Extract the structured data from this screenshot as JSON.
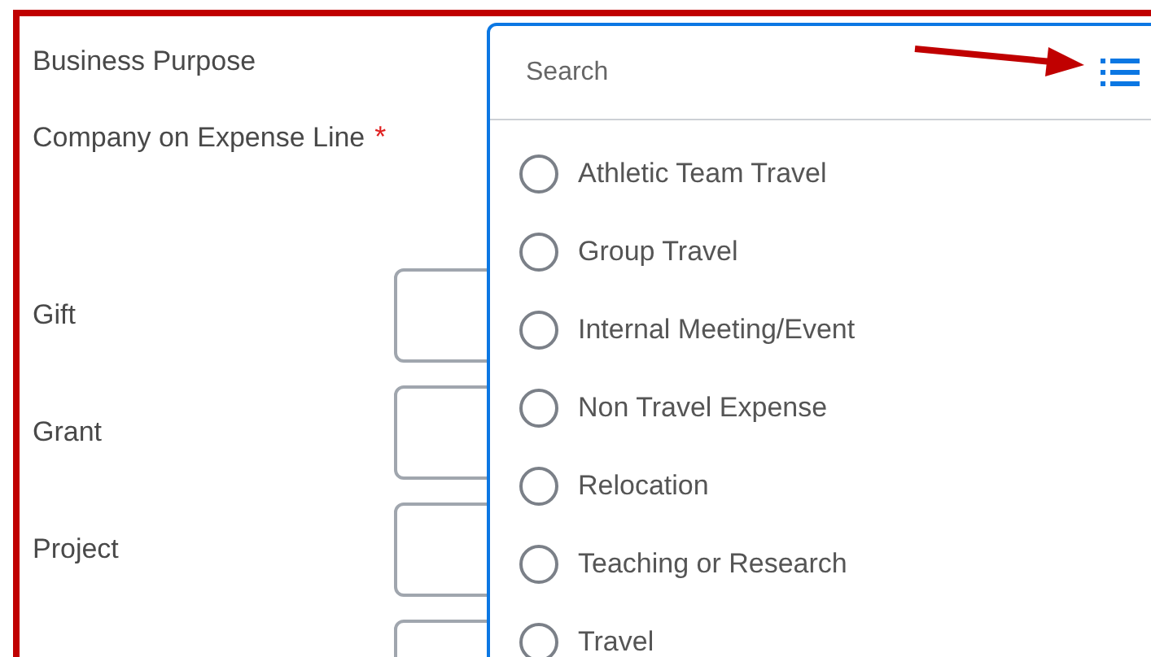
{
  "form": {
    "fields": [
      {
        "kind": "heading",
        "label": "Business Purpose"
      },
      {
        "kind": "heading",
        "label": "Company on Expense Line",
        "required_mark": "*"
      },
      {
        "kind": "input",
        "label": "Gift"
      },
      {
        "kind": "input",
        "label": "Grant"
      },
      {
        "kind": "input",
        "label": "Project"
      },
      {
        "kind": "input"
      }
    ]
  },
  "dropdown": {
    "search": {
      "placeholder": "Search"
    },
    "options": [
      {
        "label": "Athletic Team Travel",
        "selected": false
      },
      {
        "label": "Group Travel",
        "selected": false
      },
      {
        "label": "Internal Meeting/Event",
        "selected": false
      },
      {
        "label": "Non Travel Expense",
        "selected": false
      },
      {
        "label": "Relocation",
        "selected": false
      },
      {
        "label": "Teaching or Research",
        "selected": false
      },
      {
        "label": "Travel",
        "selected": false
      }
    ]
  }
}
